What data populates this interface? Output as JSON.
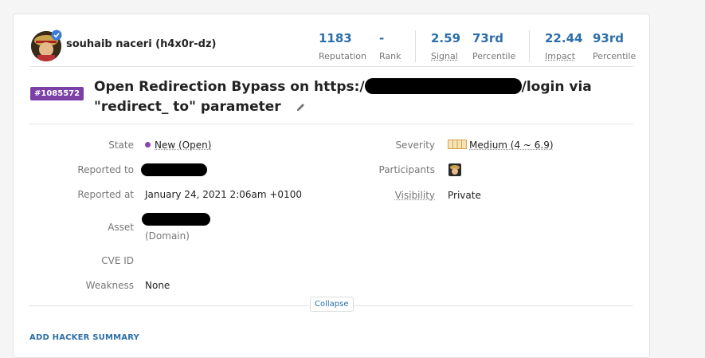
{
  "header": {
    "username": "souhaib naceri (h4x0r-dz)",
    "stats": [
      {
        "value": "1183",
        "label": "Reputation"
      },
      {
        "value": "-",
        "label": "Rank"
      },
      {
        "value": "2.59",
        "label": "Signal"
      },
      {
        "value": "73rd",
        "label": "Percentile"
      },
      {
        "value": "22.44",
        "label": "Impact"
      },
      {
        "value": "93rd",
        "label": "Percentile"
      }
    ]
  },
  "report": {
    "id_badge": "#1085572",
    "title_prefix": "Open Redirection Bypass on https:/",
    "title_suffix": "/login via \"redirect_ to\" parameter"
  },
  "details": {
    "state_label": "State",
    "state_value": "New (Open)",
    "reported_to_label": "Reported to",
    "reported_at_label": "Reported at",
    "reported_at_value": "January 24, 2021 2:06am +0100",
    "asset_label": "Asset",
    "asset_type": "(Domain)",
    "cve_label": "CVE ID",
    "weakness_label": "Weakness",
    "weakness_value": "None",
    "severity_label": "Severity",
    "severity_value": "Medium (4 ~ 6.9)",
    "participants_label": "Participants",
    "visibility_label": "Visibility",
    "visibility_value": "Private"
  },
  "actions": {
    "collapse": "Collapse",
    "add_summary": "ADD HACKER SUMMARY"
  },
  "colors": {
    "accent": "#2c6fa8",
    "badge": "#7b3fa6",
    "state_dot": "#8e44ad"
  }
}
